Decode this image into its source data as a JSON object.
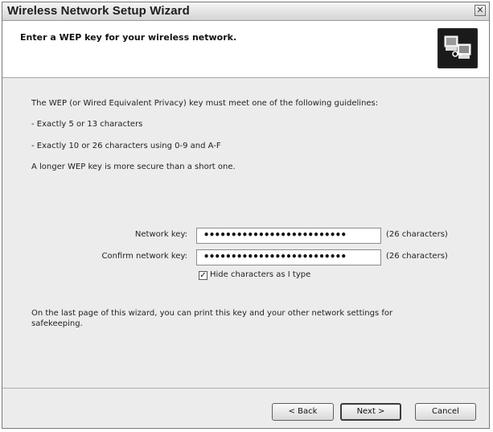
{
  "window": {
    "title": "Wireless Network Setup Wizard",
    "close_glyph": "✕"
  },
  "header": {
    "heading": "Enter a WEP key for your wireless network.",
    "icon": "wizard-network-icon"
  },
  "content": {
    "intro": "The WEP (or Wired Equivalent Privacy) key must meet one of the following guidelines:",
    "rule1": "- Exactly 5 or 13 characters",
    "rule2": "- Exactly 10 or 26 characters using 0-9 and A-F",
    "note": "A longer WEP key is more secure than a short one.",
    "network_key": {
      "label": "Network key:",
      "value": "••••••••••••••••••••••••••",
      "suffix": "(26 characters)"
    },
    "confirm_key": {
      "label": "Confirm network key:",
      "value": "••••••••••••••••••••••••••",
      "suffix": "(26 characters)"
    },
    "hide_chars": {
      "label": "Hide characters as I type",
      "checked": true,
      "check_glyph": "✓"
    },
    "print_note_line1": "On the last page of this wizard, you can print this key and your other network settings for",
    "print_note_line2": "safekeeping."
  },
  "buttons": {
    "back": "< Back",
    "next": "Next >",
    "cancel": "Cancel"
  }
}
